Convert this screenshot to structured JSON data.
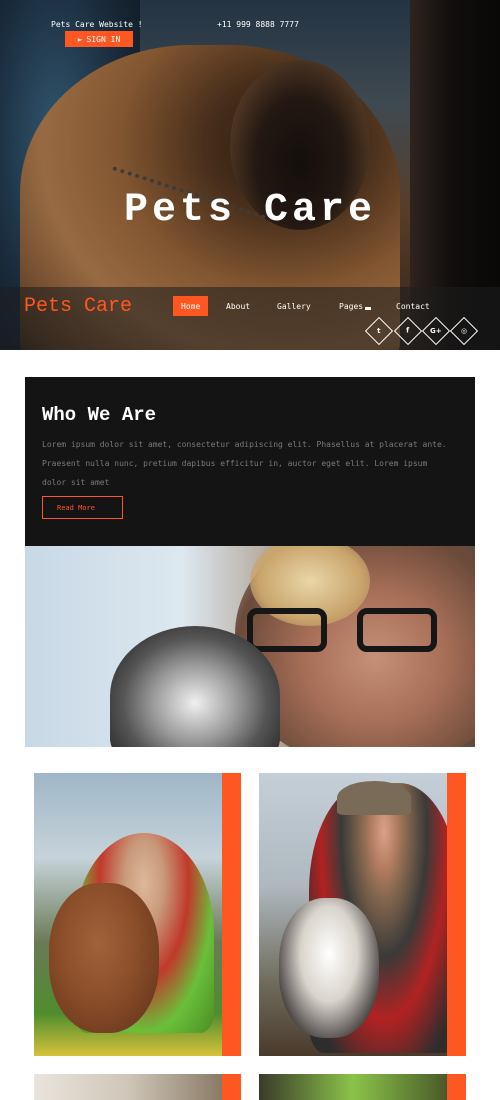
{
  "topbar": {
    "website_label": "Pets Care Website !",
    "phone": "+11 999 8888 7777",
    "signin_icon": "sign-in-icon",
    "signin_label": "SIGN IN"
  },
  "hero": {
    "title": "Pets Care"
  },
  "nav": {
    "brand": "Pets Care",
    "items": [
      {
        "label": "Home",
        "active": true
      },
      {
        "label": "About",
        "active": false
      },
      {
        "label": "Gallery",
        "active": false
      },
      {
        "label": "Pages",
        "active": false
      },
      {
        "label": "Contact",
        "active": false
      }
    ],
    "social": [
      {
        "icon": "twitter-icon",
        "glyph": "t"
      },
      {
        "icon": "facebook-icon",
        "glyph": "f"
      },
      {
        "icon": "google-plus-icon",
        "glyph": "G+"
      },
      {
        "icon": "dribbble-icon",
        "glyph": "◎"
      }
    ]
  },
  "about": {
    "title": "Who We Are",
    "text": "Lorem ipsum dolor sit amet, consectetur adipiscing elit. Phasellus at placerat ante. Praesent nulla nunc, pretium dapibus efficitur in, auctor eget elit. Lorem ipsum dolor sit amet",
    "button_label": "Read More"
  },
  "colors": {
    "accent": "#ff5722",
    "dark_panel": "#151414"
  }
}
